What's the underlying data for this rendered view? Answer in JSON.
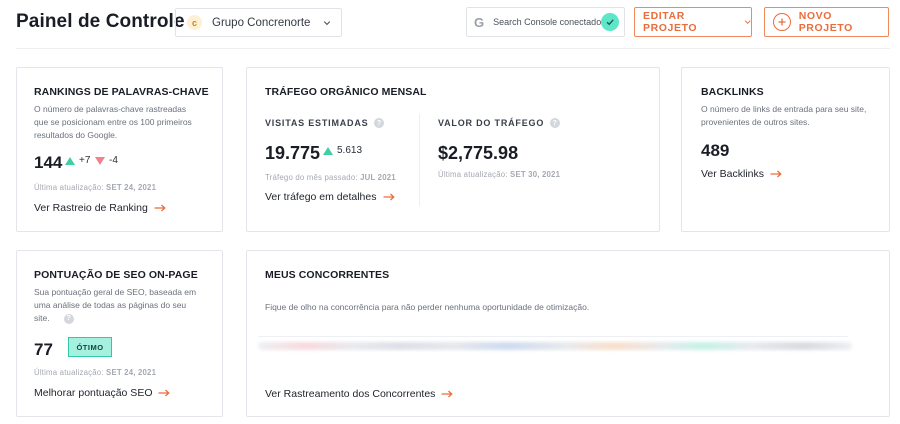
{
  "header": {
    "title": "Painel de Controle",
    "project": {
      "logo_letter": "c",
      "name": "Grupo Concrenorte"
    },
    "gsc": {
      "logo": "G",
      "text": "Search Console conectado"
    },
    "edit_label": "EDITAR PROJETO",
    "new_label": "NOVO PROJETO",
    "accent_color": "#ea6d3b"
  },
  "rankings": {
    "title": "RANKINGS DE PALAVRAS-CHAVE",
    "desc": [
      "O número de palavras-chave rastreadas",
      "que se posicionam entre os 100 primeiros",
      "resultados do Google."
    ],
    "value": "144",
    "up": "+7",
    "down": "-4",
    "updated_label": "Última atualização:",
    "updated_date": "SET 24, 2021",
    "link": "Ver Rastreio de Ranking"
  },
  "traffic": {
    "title": "TRÁFEGO ORGÂNICO MENSAL",
    "visits_label": "VISITAS ESTIMADAS",
    "visits_value": "19.775",
    "visits_delta": "5.613",
    "visits_note_label": "Tráfego do mês passado:",
    "visits_note_date": "JUL 2021",
    "value_label": "VALOR DO TRÁFEGO",
    "value_value": "$2,775.98",
    "updated_label": "Última atualização:",
    "updated_date": "SET 30, 2021",
    "link": "Ver tráfego em detalhes"
  },
  "backlinks": {
    "title": "BACKLINKS",
    "desc": [
      "O número de links de entrada para seu site,",
      "provenientes de outros sites."
    ],
    "value": "489",
    "link": "Ver Backlinks"
  },
  "seo": {
    "title": "PONTUAÇÃO DE SEO ON-PAGE",
    "desc": [
      "Sua pontuação geral de SEO, baseada em",
      "uma análise de todas as páginas do seu",
      "site."
    ],
    "value": "77",
    "badge": "ÓTIMO",
    "updated_label": "Última atualização:",
    "updated_date": "SET 24, 2021",
    "link": "Melhorar pontuação SEO"
  },
  "competitors": {
    "title": "MEUS CONCORRENTES",
    "desc": "Fique de olho na concorrência para não perder nenhuma oportunidade de otimização.",
    "link": "Ver Rastreamento dos Concorrentes"
  }
}
